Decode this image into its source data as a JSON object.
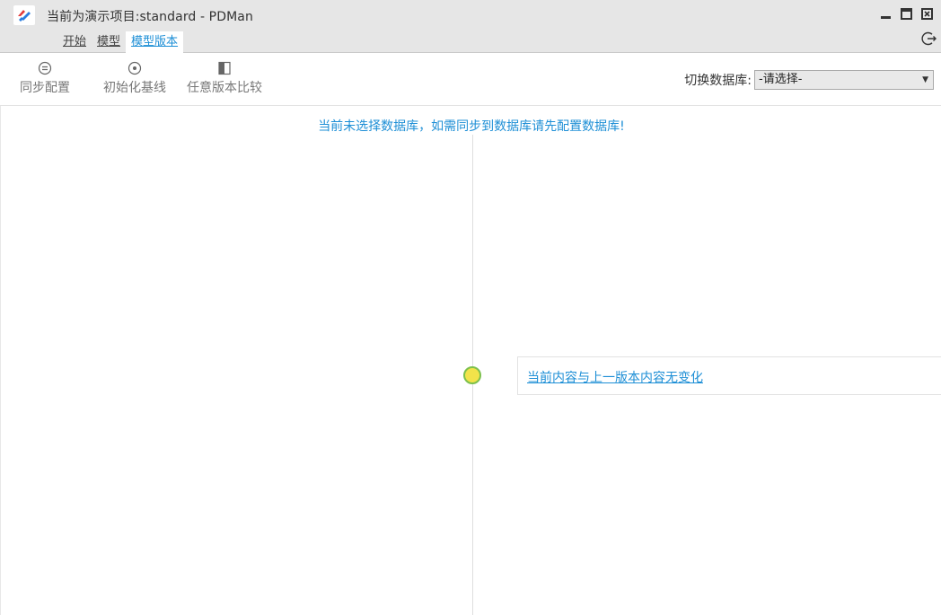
{
  "window": {
    "title": "当前为演示项目:standard - PDMan",
    "logo_icon": "pdman-logo-icon",
    "controls": [
      "minimize-icon",
      "maximize-icon",
      "close-icon"
    ]
  },
  "menu": {
    "tabs": [
      {
        "label": "开始",
        "active": false
      },
      {
        "label": "模型",
        "active": false
      },
      {
        "label": "模型版本",
        "active": true
      }
    ]
  },
  "toolbar": {
    "buttons": [
      {
        "label": "同步配置",
        "icon": "sync-config-icon"
      },
      {
        "label": "初始化基线",
        "icon": "init-baseline-icon"
      },
      {
        "label": "任意版本比较",
        "icon": "compare-version-icon"
      }
    ],
    "db_switch": {
      "label": "切换数据库:",
      "selected": "-请选择-"
    }
  },
  "main": {
    "notice": "当前未选择数据库，如需同步到数据库请先配置数据库!",
    "version_entry": {
      "text": "当前内容与上一版本内容无变化"
    }
  },
  "colors": {
    "accent": "#1e8fd6",
    "node_fill": "#f2e34a",
    "node_border": "#7cc04d"
  }
}
